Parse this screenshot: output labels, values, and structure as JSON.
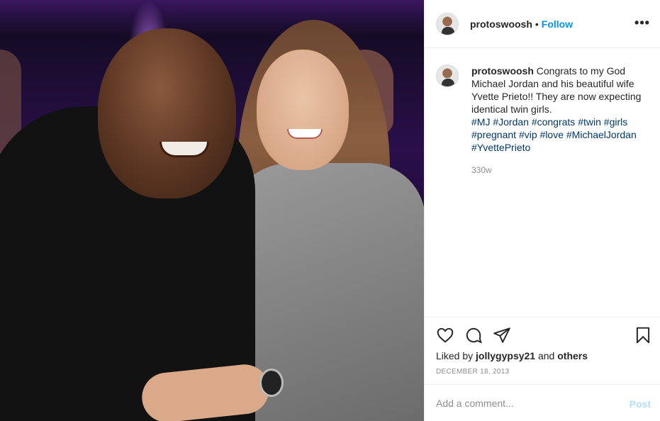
{
  "header": {
    "username": "protoswoosh",
    "separator": "•",
    "follow_label": "Follow",
    "more_icon": "more-options-icon",
    "more_glyph": "•••"
  },
  "caption": {
    "username": "protoswoosh",
    "text": "Congrats to my God Michael Jordan and his beautiful wife Yvette Prieto!! They are now expecting identical twin girls.",
    "hashtags": [
      "#MJ",
      "#Jordan",
      "#congrats",
      "#twin",
      "#girls",
      "#pregnant",
      "#vip",
      "#love",
      "#MichaelJordan",
      "#YvettePrieto"
    ],
    "time": "330w"
  },
  "actions": {
    "icons": [
      "heart-icon",
      "comment-icon",
      "share-icon",
      "bookmark-icon"
    ]
  },
  "likes": {
    "prefix": "Liked by",
    "user": "jollygypsy21",
    "conjunction": "and",
    "others": "others"
  },
  "date": "DECEMBER 18, 2013",
  "add_comment": {
    "placeholder": "Add a comment...",
    "post_label": "Post"
  },
  "colors": {
    "link_blue": "#0095f6",
    "hashtag": "#00376b",
    "post_disabled": "#b2dffc",
    "muted": "#8e8e8e"
  }
}
